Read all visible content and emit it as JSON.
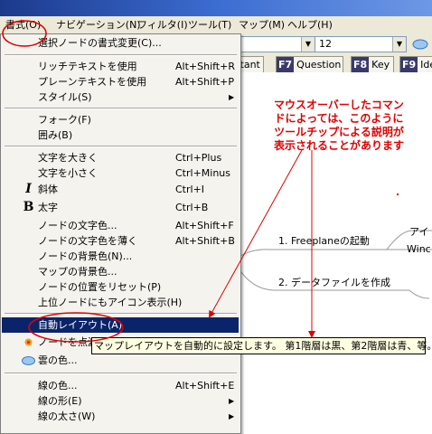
{
  "menubar": {
    "items": [
      {
        "label": "書式(O)"
      },
      {
        "label": "ナビゲーション(N)"
      },
      {
        "label": "フィルタ(I)"
      },
      {
        "label": "ツール(T)"
      },
      {
        "label": "マップ(M)"
      },
      {
        "label": "ヘルプ(H)"
      }
    ]
  },
  "toolbar": {
    "font_size_value": "12"
  },
  "keybar": {
    "keys": [
      {
        "num": "",
        "label": "rtant"
      },
      {
        "num": "F7",
        "label": "Question"
      },
      {
        "num": "F8",
        "label": "Key"
      },
      {
        "num": "F9",
        "label": "Ide"
      }
    ]
  },
  "format_menu": {
    "items": [
      {
        "label": "選択ノードの書式変更(C)...",
        "shortcut": ""
      },
      {
        "label": "リッチテキストを使用",
        "shortcut": "Alt+Shift+R"
      },
      {
        "label": "プレーンテキストを使用",
        "shortcut": "Alt+Shift+P"
      },
      {
        "label": "スタイル(S)",
        "shortcut": ""
      },
      {
        "label": "フォーク(F)",
        "shortcut": ""
      },
      {
        "label": "囲み(B)",
        "shortcut": ""
      },
      {
        "label": "文字を大きく",
        "shortcut": "Ctrl+Plus"
      },
      {
        "label": "文字を小さく",
        "shortcut": "Ctrl+Minus"
      },
      {
        "label": "斜体",
        "shortcut": "Ctrl+I"
      },
      {
        "label": "太字",
        "shortcut": "Ctrl+B"
      },
      {
        "label": "ノードの文字色...",
        "shortcut": "Alt+Shift+F"
      },
      {
        "label": "ノードの文字色を薄く",
        "shortcut": "Alt+Shift+B"
      },
      {
        "label": "ノードの背景色(N)...",
        "shortcut": ""
      },
      {
        "label": "マップの背景色...",
        "shortcut": ""
      },
      {
        "label": "ノードの位置をリセット(P)",
        "shortcut": ""
      },
      {
        "label": "上位ノードにもアイコン表示(H)",
        "shortcut": ""
      },
      {
        "label": "自動レイアウト(A)",
        "shortcut": ""
      },
      {
        "label": "ノードを点滅",
        "shortcut": ""
      },
      {
        "label": "雲の色...",
        "shortcut": ""
      },
      {
        "label": "線の色...",
        "shortcut": "Alt+Shift+E"
      },
      {
        "label": "線の形(E)",
        "shortcut": ""
      },
      {
        "label": "線の太さ(W)",
        "shortcut": ""
      }
    ]
  },
  "icons": {
    "italic": "I",
    "bold": "B"
  },
  "tooltip": {
    "text": "マップレイアウトを自動的に設定します。 第1階層は黒、第2階層は青、等。"
  },
  "annotation": {
    "lines": [
      "マウスオーバーしたコマン",
      "ドによっては、このように",
      "ツールチップによる説明が",
      "表示されることがあります"
    ]
  },
  "mindmap": {
    "nodes": [
      {
        "label": "1. Freeplaneの起動"
      },
      {
        "label": "2. データファイルを作成"
      },
      {
        "label": "アイ"
      },
      {
        "label": "Winc"
      }
    ]
  },
  "colors": {
    "annotation_red": "#e00000",
    "selection_blue": "#0a246a",
    "tooltip_bg": "#ffffe1"
  }
}
